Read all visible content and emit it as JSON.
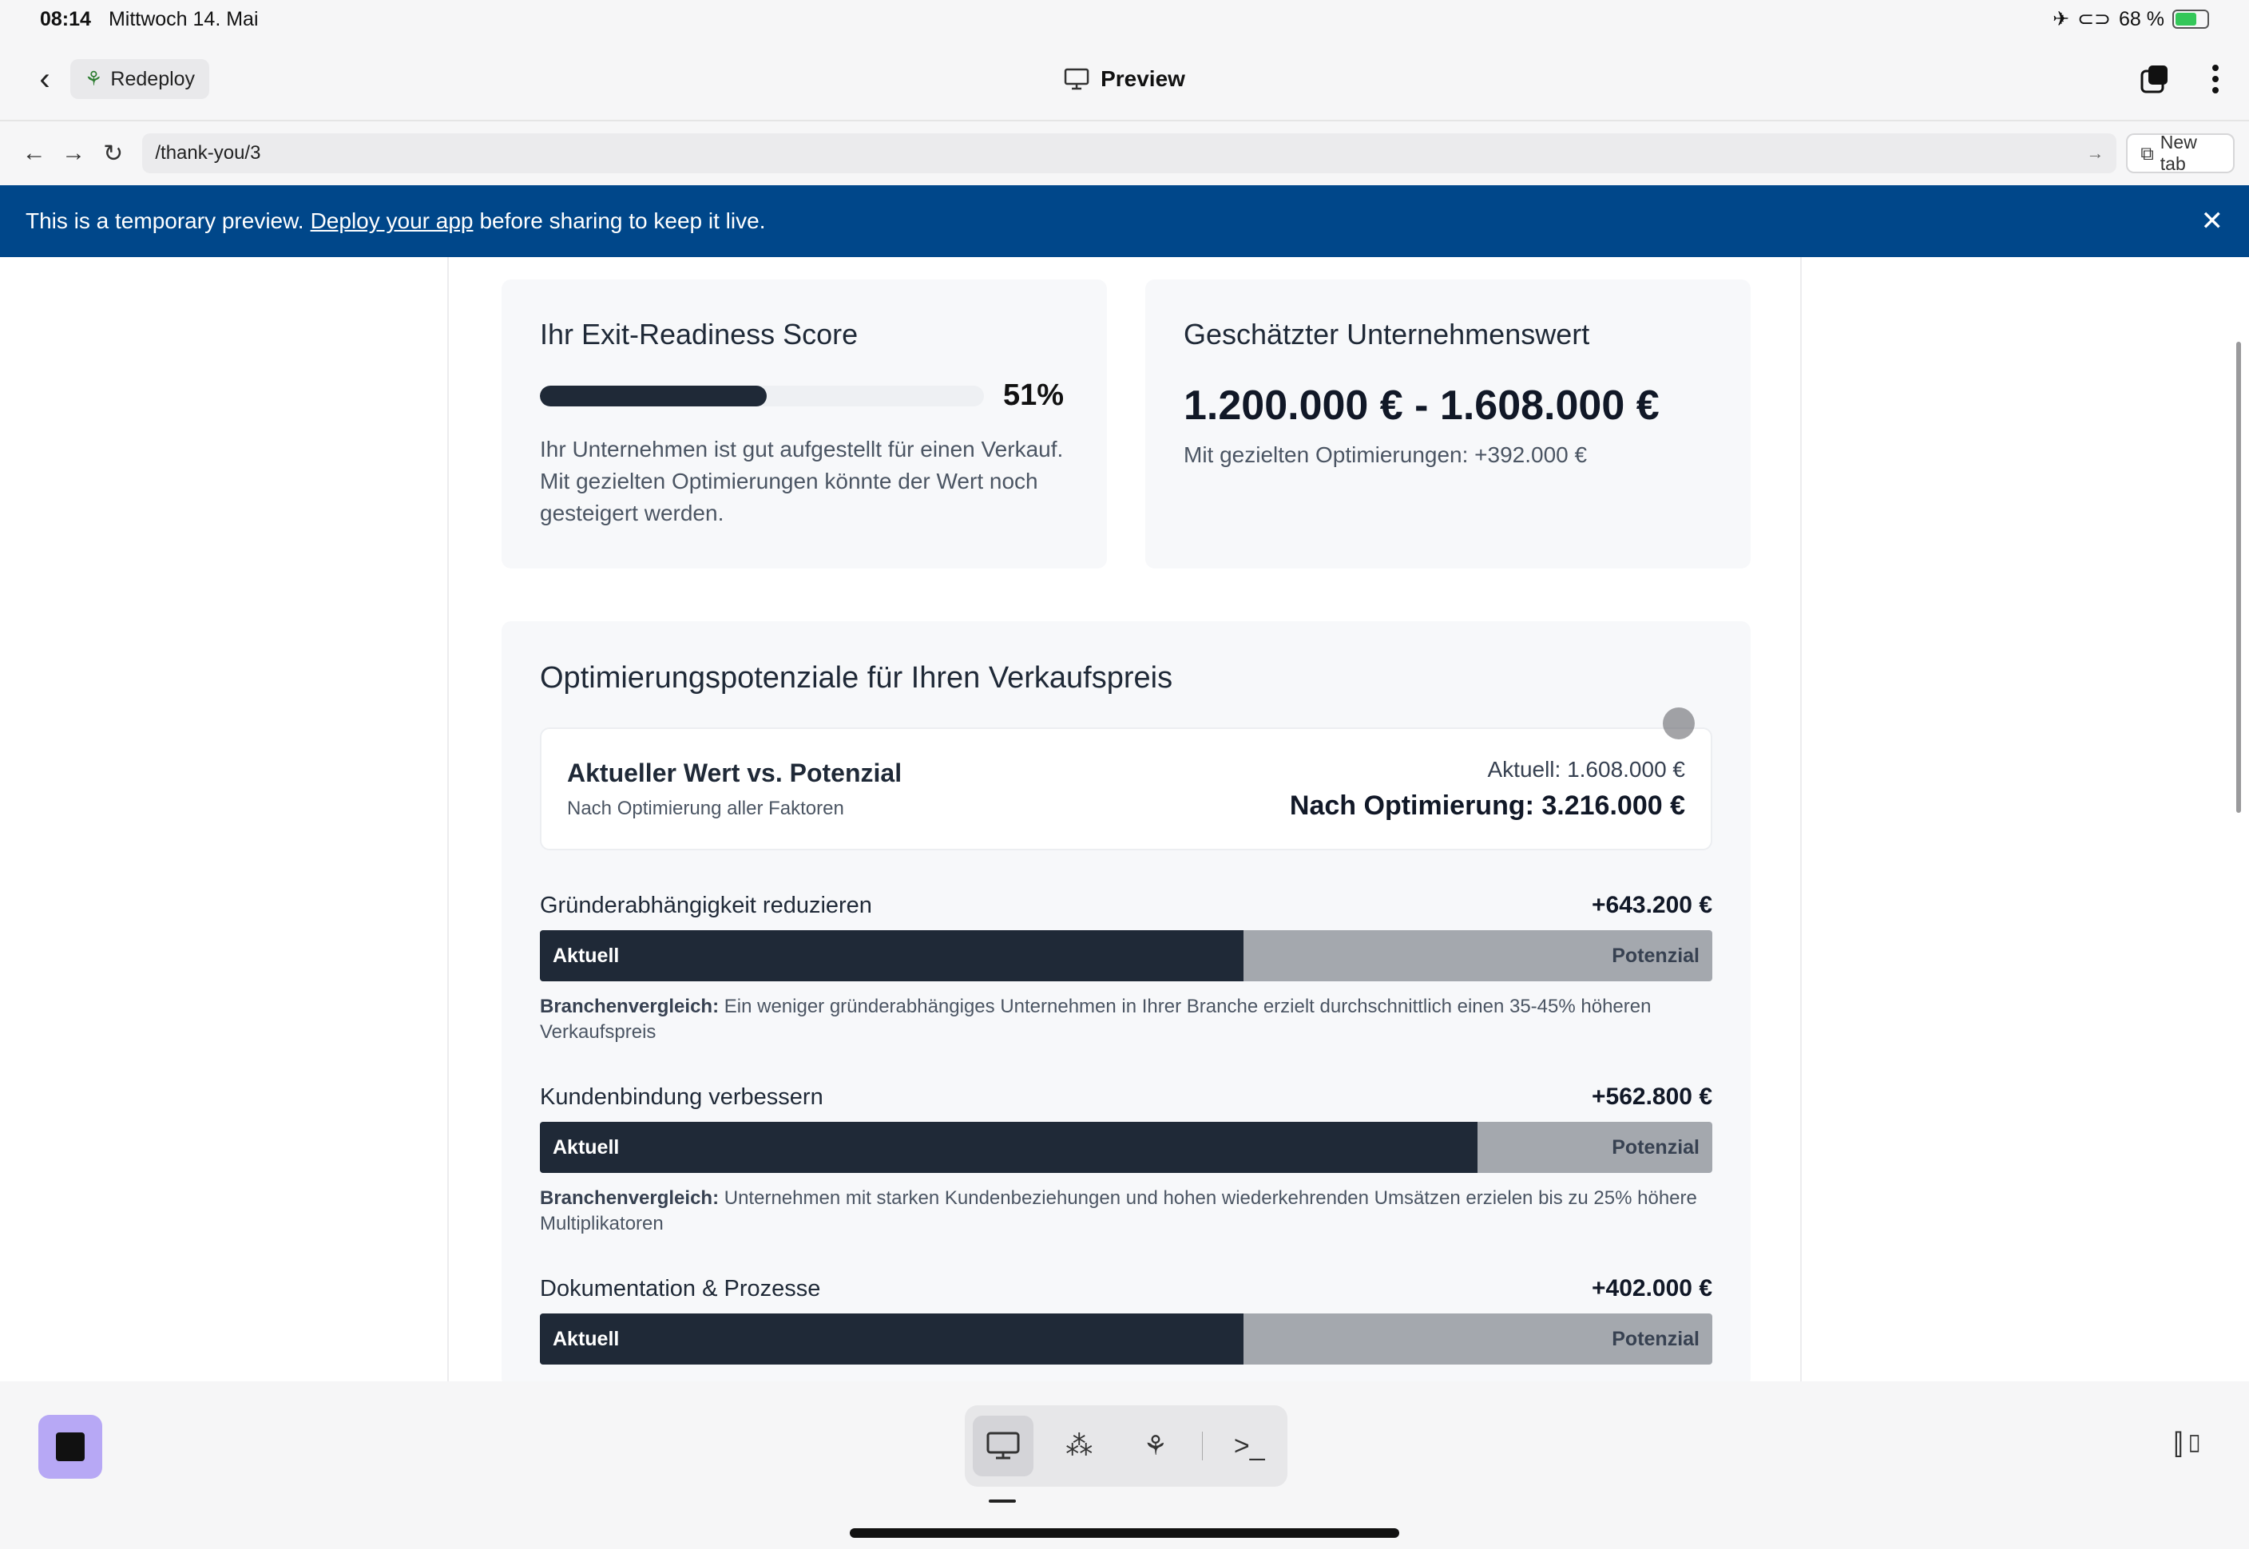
{
  "status_bar": {
    "time": "08:14",
    "date": "Mittwoch 14. Mai",
    "battery": "68 %",
    "battery_level": 0.68
  },
  "app_bar": {
    "redeploy_label": "Redeploy",
    "title": "Preview"
  },
  "url_bar": {
    "url": "/thank-you/3",
    "new_tab_label": "New tab"
  },
  "banner": {
    "text_before": "This is a temporary preview.",
    "link": "Deploy your app",
    "text_after": "before sharing to keep it live."
  },
  "score_card": {
    "title": "Ihr Exit-Readiness Score",
    "percent_label": "51%",
    "percent_value": 0.51,
    "description": "Ihr Unternehmen ist gut aufgestellt für einen Verkauf. Mit gezielten Optimierungen könnte der Wert noch gesteigert werden."
  },
  "value_card": {
    "title": "Geschätzter Unternehmenswert",
    "range": "1.200.000 € - 1.608.000 €",
    "optimization": "Mit gezielten Optimierungen: +392.000 €"
  },
  "optimization": {
    "title": "Optimierungspotenziale für Ihren Verkaufspreis",
    "compare_title": "Aktueller Wert vs. Potenzial",
    "compare_subtitle": "Nach Optimierung aller Faktoren",
    "current": "Aktuell: 1.608.000 €",
    "after": "Nach Optimierung: 3.216.000 €",
    "factors": [
      {
        "name": "Gründerabhängigkeit reduzieren",
        "amount": "+643.200 €",
        "current_fraction": 0.6,
        "label_current": "Aktuell",
        "label_potential": "Potenzial",
        "bench_label": "Branchenvergleich:",
        "bench_text": "Ein weniger gründerabhängiges Unternehmen in Ihrer Branche erzielt durchschnittlich einen 35-45% höheren Verkaufspreis"
      },
      {
        "name": "Kundenbindung verbessern",
        "amount": "+562.800 €",
        "current_fraction": 0.8,
        "label_current": "Aktuell",
        "label_potential": "Potenzial",
        "bench_label": "Branchenvergleich:",
        "bench_text": "Unternehmen mit starken Kundenbeziehungen und hohen wiederkehrenden Umsätzen erzielen bis zu 25% höhere Multiplikatoren"
      },
      {
        "name": "Dokumentation & Prozesse",
        "amount": "+402.000 €",
        "current_fraction": 0.6,
        "label_current": "Aktuell",
        "label_potential": "Potenzial"
      }
    ]
  },
  "icons": [
    "back-icon",
    "redeploy-icon",
    "monitor-icon",
    "tabs-icon",
    "more-icon",
    "arrow-left-icon",
    "arrow-right-icon",
    "reload-icon",
    "external-link-icon",
    "close-icon",
    "stop-icon",
    "apps-icon",
    "deploy-icon",
    "terminal-icon",
    "panel-toggle-icon"
  ]
}
